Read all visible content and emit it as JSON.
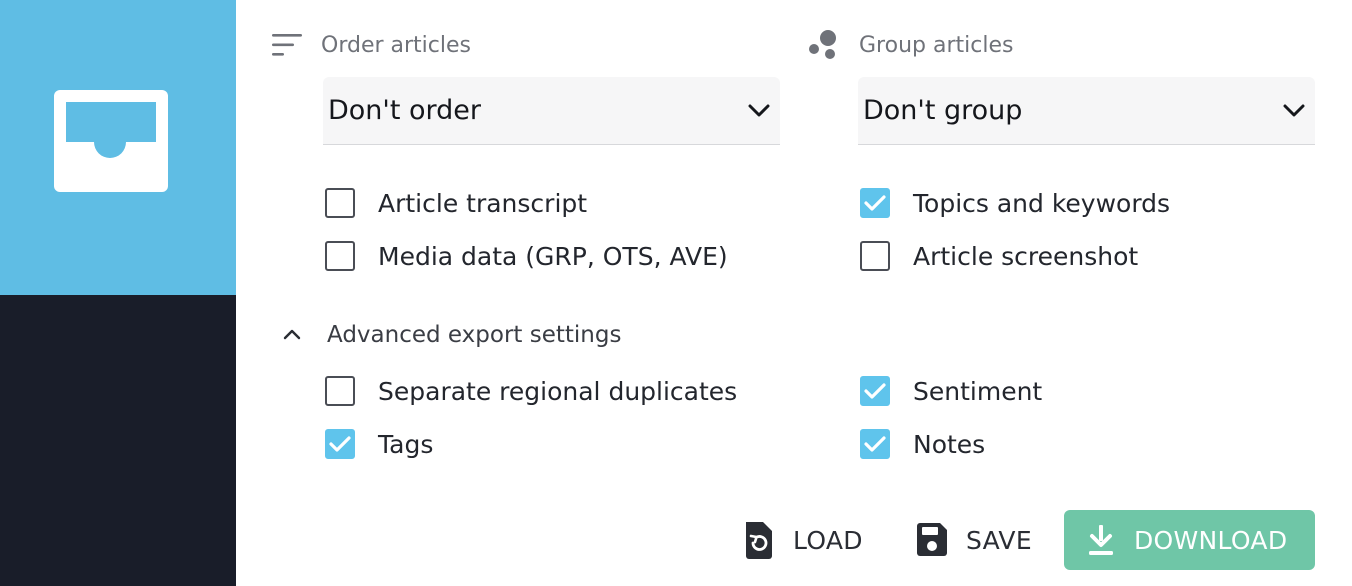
{
  "order": {
    "header_label": "Order articles",
    "header_icon": "sort-icon",
    "selected": "Don't order"
  },
  "group": {
    "header_label": "Group articles",
    "header_icon": "group-bubbles-icon",
    "selected": "Don't group"
  },
  "options": {
    "left": [
      {
        "label": "Article transcript",
        "checked": false
      },
      {
        "label": "Media data (GRP, OTS, AVE)",
        "checked": false
      }
    ],
    "right": [
      {
        "label": "Topics and keywords",
        "checked": true
      },
      {
        "label": "Article screenshot",
        "checked": false
      }
    ]
  },
  "advanced": {
    "label": "Advanced export settings",
    "expanded": true,
    "left": [
      {
        "label": "Separate regional duplicates",
        "checked": false
      },
      {
        "label": "Tags",
        "checked": true
      }
    ],
    "right": [
      {
        "label": "Sentiment",
        "checked": true
      },
      {
        "label": "Notes",
        "checked": true
      }
    ]
  },
  "actions": {
    "load_label": "LOAD",
    "save_label": "SAVE",
    "download_label": "DOWNLOAD"
  },
  "colors": {
    "sidebar_top": "#5fbde4",
    "sidebar_bottom": "#191d29",
    "checkbox_checked": "#5fc4ec",
    "download_button": "#6fc6a7"
  }
}
